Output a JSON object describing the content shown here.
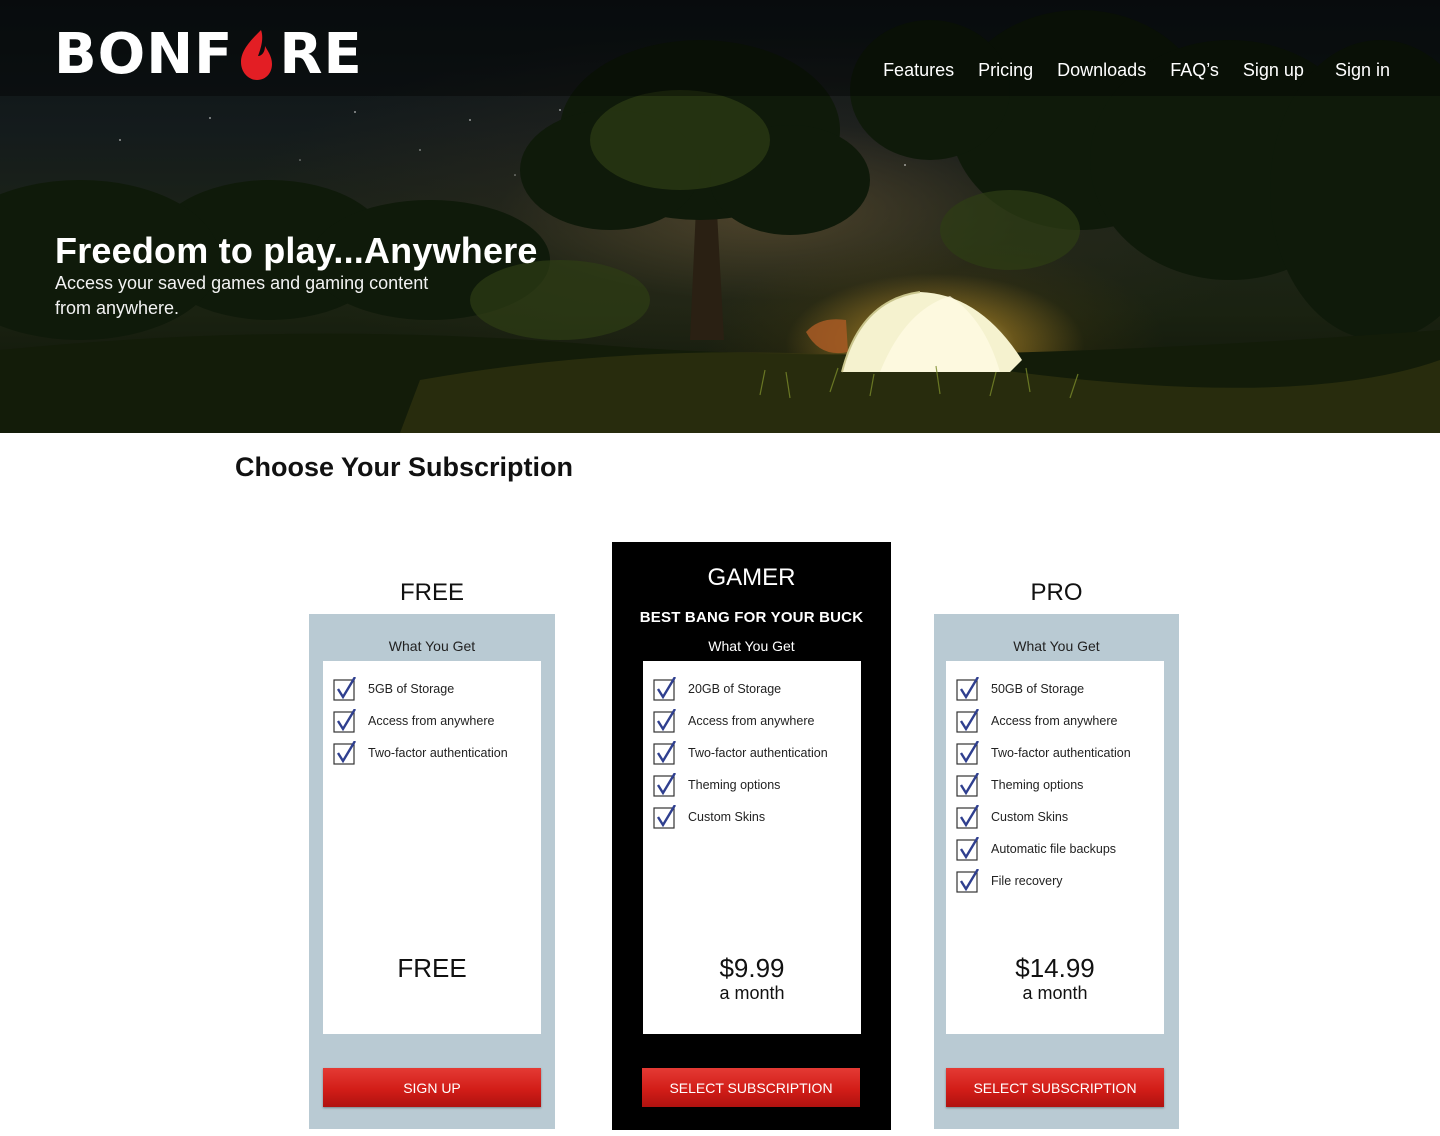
{
  "brand": {
    "logo_left": "BONF",
    "logo_right": "RE",
    "logo_accent": "#e31e24"
  },
  "nav": {
    "items": [
      "Features",
      "Pricing",
      "Downloads",
      "FAQ’s",
      "Sign up",
      "Sign in"
    ]
  },
  "hero": {
    "title": "Freedom to play...Anywhere",
    "subtitle": "Access your saved games and gaming content from anywhere."
  },
  "section": {
    "title": "Choose Your Subscription"
  },
  "plans": [
    {
      "name": "FREE",
      "what_you_get": "What You Get",
      "features": [
        "5GB of Storage",
        "Access from anywhere",
        "Two-factor authentication"
      ],
      "price": "FREE",
      "period": "",
      "button": "SIGN UP"
    },
    {
      "name": "GAMER",
      "tagline": "BEST BANG FOR YOUR BUCK",
      "what_you_get": "What You Get",
      "features": [
        "20GB of Storage",
        "Access from anywhere",
        "Two-factor authentication",
        "Theming options",
        "Custom Skins"
      ],
      "price": "$9.99",
      "period": "a month",
      "button": "SELECT SUBSCRIPTION"
    },
    {
      "name": "PRO",
      "what_you_get": "What You Get",
      "features": [
        "50GB of Storage",
        "Access from anywhere",
        "Two-factor authentication",
        "Theming options",
        "Custom Skins",
        "Automatic file backups",
        "File recovery"
      ],
      "price": "$14.99",
      "period": "a month",
      "button": "SELECT SUBSCRIPTION"
    }
  ],
  "colors": {
    "card_light": "#b9cad3",
    "card_dark": "#000000",
    "button_red": "#d21d18",
    "checkmark": "#2f3f8f"
  }
}
